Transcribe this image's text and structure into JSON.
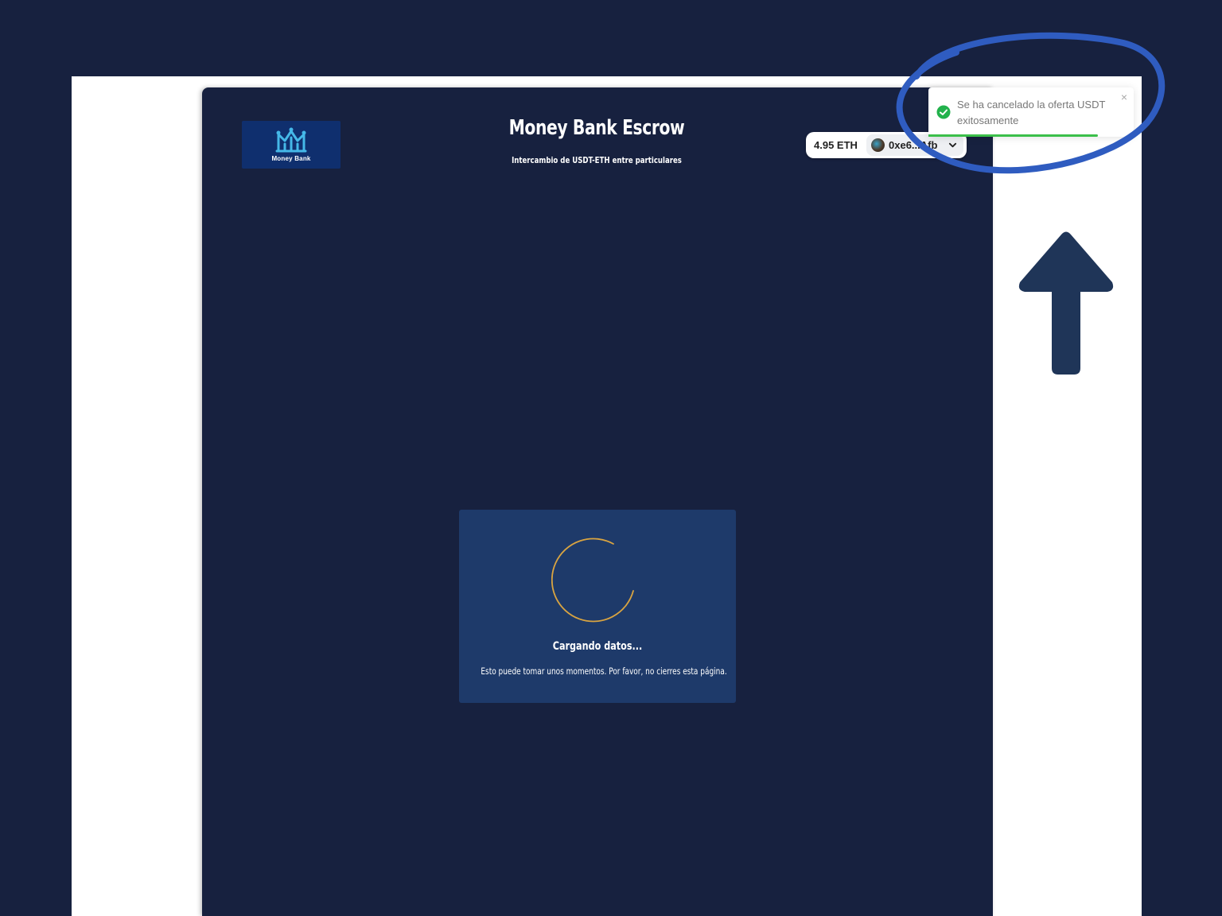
{
  "header": {
    "logo_text": "Money Bank",
    "title": "Money Bank Escrow",
    "subtitle": "Intercambio de USDT-ETH entre particulares"
  },
  "wallet": {
    "balance": "4.95 ETH",
    "address": "0xe6...Afb"
  },
  "toast": {
    "message": "Se ha cancelado la oferta USDT exitosamente",
    "close_symbol": "×",
    "status_color": "#22b24c"
  },
  "loading": {
    "title": "Cargando datos...",
    "message": "Esto puede tomar unos momentos. Por favor, no cierres esta página."
  },
  "colors": {
    "background": "#17213f",
    "card": "#1e3a6a",
    "spinner": "#d9a441",
    "annotation": "#2f5cc0",
    "arrow": "#1f3558"
  }
}
